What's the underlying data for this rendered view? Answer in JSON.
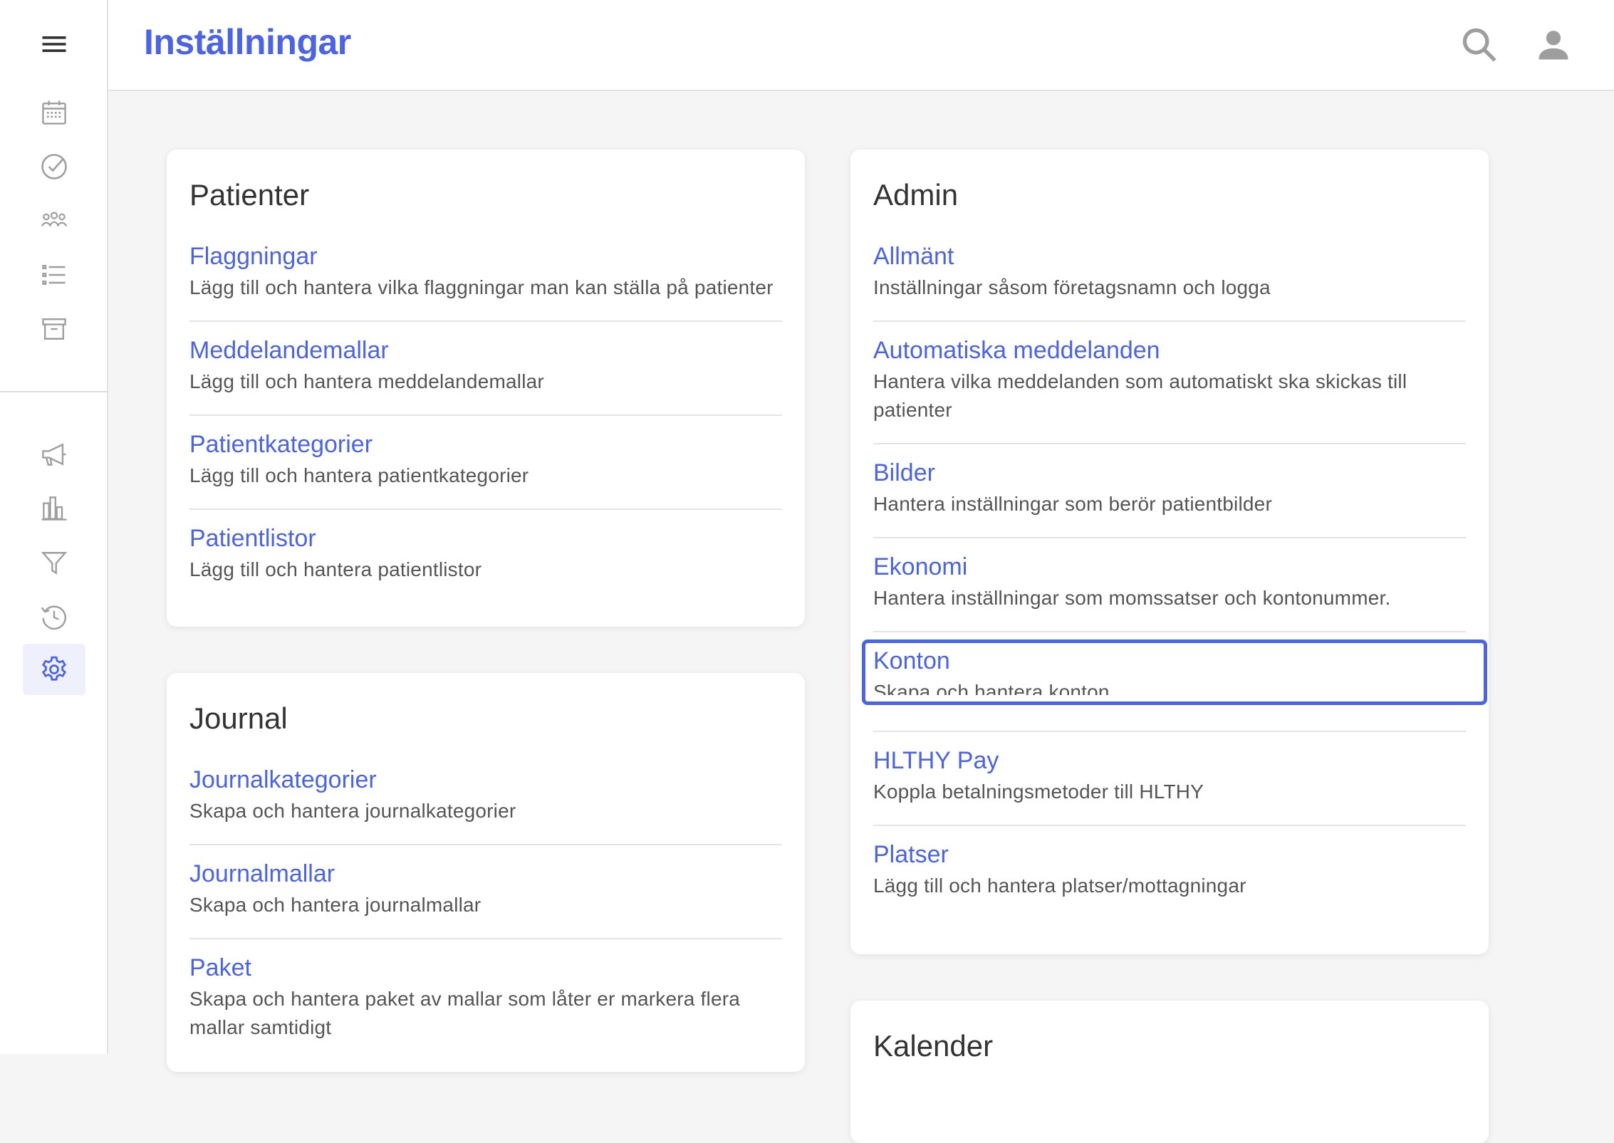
{
  "header": {
    "title": "Inställningar"
  },
  "sidebar": {
    "items": [
      {
        "icon": "menu-icon"
      },
      {
        "icon": "calendar-icon"
      },
      {
        "icon": "check-circle-icon"
      },
      {
        "icon": "people-group-icon"
      },
      {
        "icon": "list-icon"
      },
      {
        "icon": "archive-icon"
      },
      {
        "icon": "megaphone-icon"
      },
      {
        "icon": "bar-chart-icon"
      },
      {
        "icon": "filter-icon"
      },
      {
        "icon": "history-icon"
      },
      {
        "icon": "settings-gear-icon",
        "active": true
      }
    ]
  },
  "colors": {
    "accent": "#4a63e7",
    "background": "#f5f5f5",
    "text": "#555555"
  },
  "cards": {
    "patienter": {
      "title": "Patienter",
      "items": [
        {
          "title": "Flaggningar",
          "desc": "Lägg till och hantera vilka flaggningar man kan ställa på patienter"
        },
        {
          "title": "Meddelandemallar",
          "desc": "Lägg till och hantera meddelandemallar"
        },
        {
          "title": "Patientkategorier",
          "desc": "Lägg till och hantera patientkategorier"
        },
        {
          "title": "Patientlistor",
          "desc": "Lägg till och hantera patientlistor"
        }
      ]
    },
    "journal": {
      "title": "Journal",
      "items": [
        {
          "title": "Journalkategorier",
          "desc": "Skapa och hantera journalkategorier"
        },
        {
          "title": "Journalmallar",
          "desc": "Skapa och hantera journalmallar"
        },
        {
          "title": "Paket",
          "desc": "Skapa och hantera paket av mallar som låter er markera flera mallar samtidigt"
        }
      ]
    },
    "admin": {
      "title": "Admin",
      "items": [
        {
          "title": "Allmänt",
          "desc": "Inställningar såsom företagsnamn och logga"
        },
        {
          "title": "Automatiska meddelanden",
          "desc": "Hantera vilka meddelanden som automatiskt ska skickas till patienter"
        },
        {
          "title": "Bilder",
          "desc": "Hantera inställningar som berör patientbilder"
        },
        {
          "title": "Ekonomi",
          "desc": "Hantera inställningar som momssatser och kontonummer."
        },
        {
          "title": "Konton",
          "desc": "Skapa och hantera konton"
        },
        {
          "title": "HLTHY Pay",
          "desc": "Koppla betalningsmetoder till HLTHY"
        },
        {
          "title": "Platser",
          "desc": "Lägg till och hantera platser/mottagningar"
        }
      ]
    },
    "kalender": {
      "title": "Kalender"
    }
  }
}
